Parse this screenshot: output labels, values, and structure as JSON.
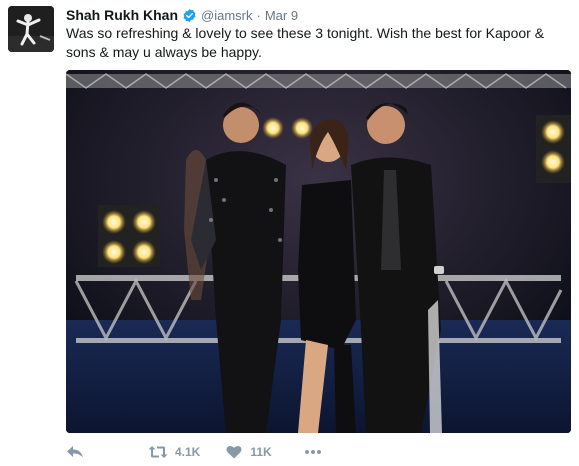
{
  "tweet": {
    "author": {
      "fullname": "Shah Rukh Khan",
      "username": "@iamsrk",
      "verified": true,
      "avatar_icon": "profile-photo-dancer"
    },
    "separator": "·",
    "time": "Mar 9",
    "text": "Was so refreshing & lovely to see these 3 tonight. Wish the best for Kapoor & sons & may u always be happy.",
    "media": {
      "type": "photo",
      "description_icon": "photo-three-people-on-stage"
    },
    "actions": {
      "reply_icon": "reply-icon",
      "retweet_icon": "retweet-icon",
      "retweet_count": "4.1K",
      "like_icon": "heart-icon",
      "like_count": "11K",
      "more_icon": "more-dots-icon"
    }
  },
  "colors": {
    "name": "#14171a",
    "secondary": "#657786",
    "action": "#8899a6",
    "verified": "#1da1f2"
  }
}
